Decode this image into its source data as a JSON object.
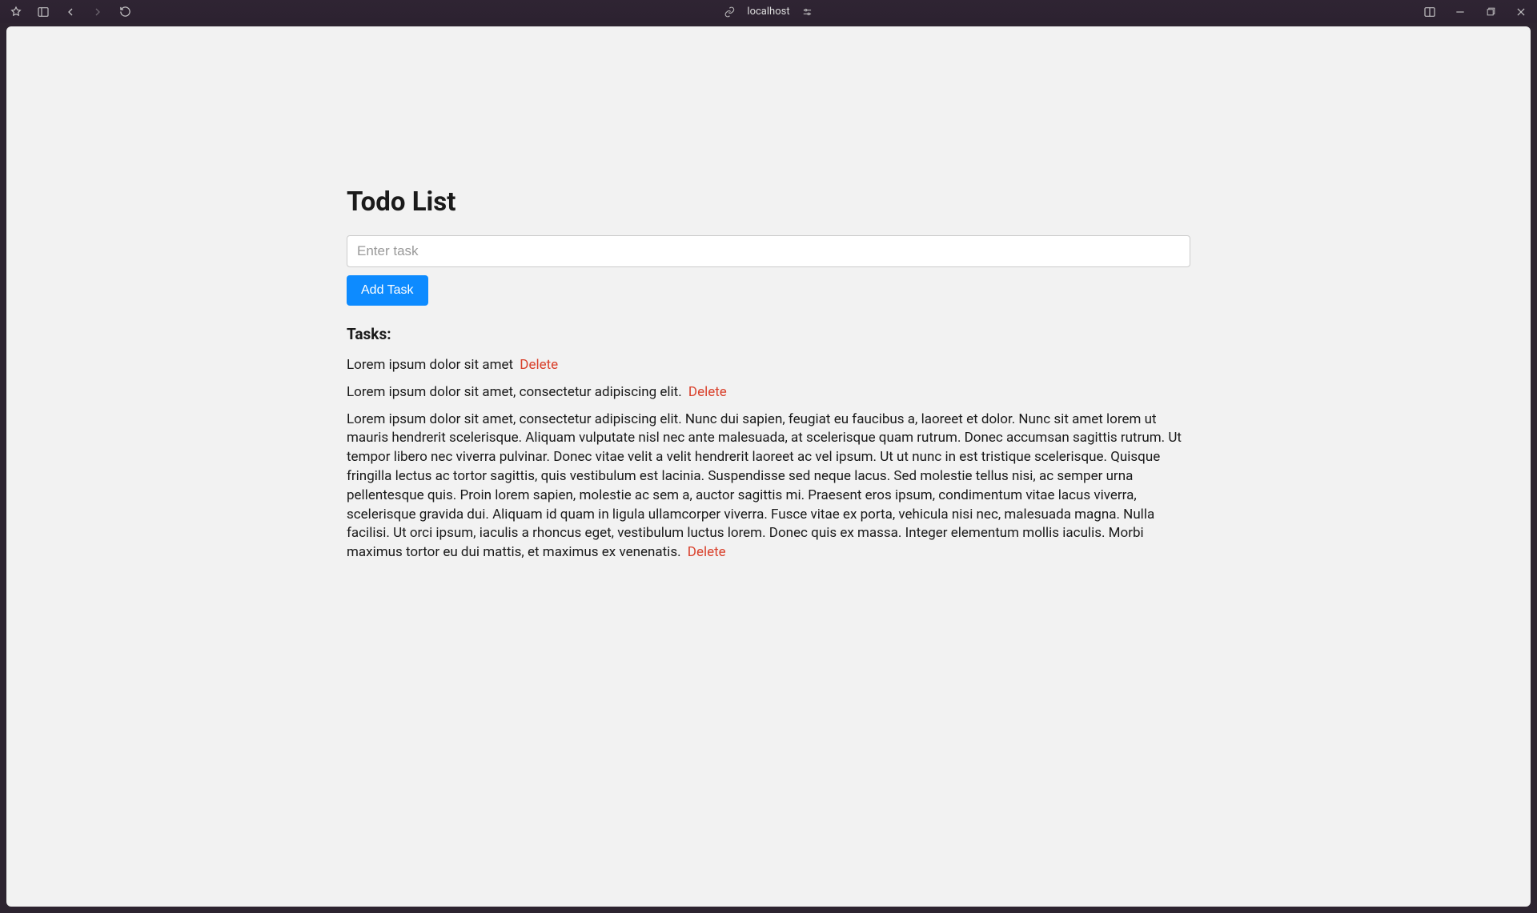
{
  "browser": {
    "url_label": "localhost"
  },
  "page": {
    "title": "Todo List",
    "input_placeholder": "Enter task",
    "add_button_label": "Add Task",
    "tasks_heading": "Tasks:",
    "delete_label": "Delete",
    "tasks": [
      {
        "text": "Lorem ipsum dolor sit amet"
      },
      {
        "text": "Lorem ipsum dolor sit amet, consectetur adipiscing elit."
      },
      {
        "text": "Lorem ipsum dolor sit amet, consectetur adipiscing elit. Nunc dui sapien, feugiat eu faucibus a, laoreet et dolor. Nunc sit amet lorem ut mauris hendrerit scelerisque. Aliquam vulputate nisl nec ante malesuada, at scelerisque quam rutrum. Donec accumsan sagittis rutrum. Ut tempor libero nec viverra pulvinar. Donec vitae velit a velit hendrerit laoreet ac vel ipsum. Ut ut nunc in est tristique scelerisque. Quisque fringilla lectus ac tortor sagittis, quis vestibulum est lacinia. Suspendisse sed neque lacus. Sed molestie tellus nisi, ac semper urna pellentesque quis. Proin lorem sapien, molestie ac sem a, auctor sagittis mi. Praesent eros ipsum, condimentum vitae lacus viverra, scelerisque gravida dui. Aliquam id quam in ligula ullamcorper viverra. Fusce vitae ex porta, vehicula nisi nec, malesuada magna. Nulla facilisi. Ut orci ipsum, iaculis a rhoncus eget, vestibulum luctus lorem. Donec quis ex massa. Integer elementum mollis iaculis. Morbi maximus tortor eu dui mattis, et maximus ex venenatis."
      }
    ]
  }
}
